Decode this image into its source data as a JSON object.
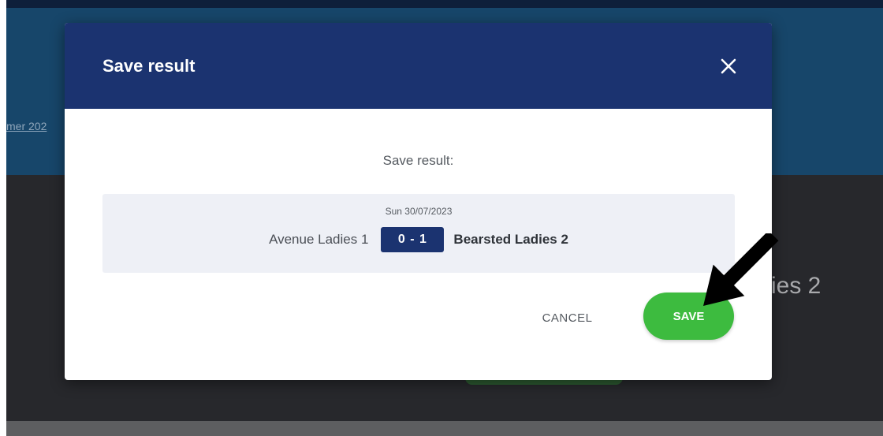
{
  "background": {
    "date_fragment": "mer 202",
    "team_fragment": "ies 2"
  },
  "modal": {
    "title": "Save result",
    "label": "Save result:",
    "match": {
      "date": "Sun 30/07/2023",
      "home_team": "Avenue Ladies 1",
      "score": "0 - 1",
      "away_team": "Bearsted Ladies 2"
    },
    "cancel_label": "CANCEL",
    "save_label": "SAVE"
  },
  "colors": {
    "header": "#1b3370",
    "save_button": "#3dbb3f",
    "card_bg": "#eef0f6"
  },
  "icons": {
    "close": "close-icon",
    "pointer": "arrow-pointer-icon"
  }
}
